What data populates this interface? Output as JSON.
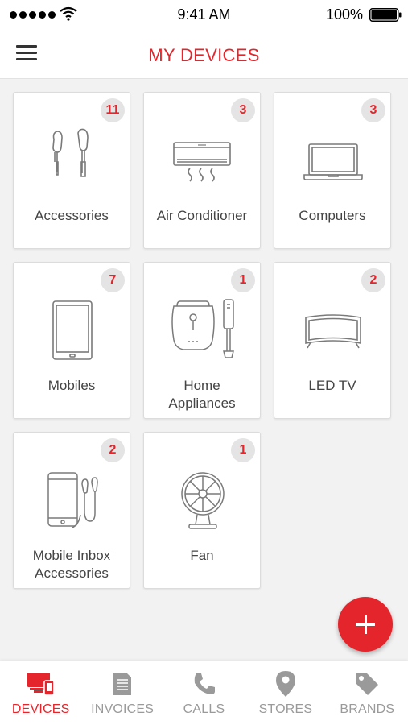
{
  "status_bar": {
    "time": "9:41 AM",
    "battery_pct": "100%"
  },
  "header": {
    "title": "MY DEVICES"
  },
  "devices": [
    {
      "label": "Accessories",
      "count": "11",
      "icon": "earphones-icon"
    },
    {
      "label": "Air Conditioner",
      "count": "3",
      "icon": "air-conditioner-icon"
    },
    {
      "label": "Computers",
      "count": "3",
      "icon": "laptop-icon"
    },
    {
      "label": "Mobiles",
      "count": "7",
      "icon": "tablet-icon"
    },
    {
      "label_line1": "Home",
      "label_line2": "Appliances",
      "count": "1",
      "icon": "home-appliances-icon"
    },
    {
      "label": "LED TV",
      "count": "2",
      "icon": "led-tv-icon"
    },
    {
      "label_line1": "Mobile Inbox",
      "label_line2": "Accessories",
      "count": "2",
      "icon": "phone-earphones-icon"
    },
    {
      "label": "Fan",
      "count": "1",
      "icon": "fan-icon"
    }
  ],
  "fab": {
    "icon": "plus-icon"
  },
  "tabs": [
    {
      "label": "DEVICES",
      "icon": "devices-icon",
      "active": true
    },
    {
      "label": "INVOICES",
      "icon": "document-icon",
      "active": false
    },
    {
      "label": "CALLS",
      "icon": "phone-icon",
      "active": false
    },
    {
      "label": "STORES",
      "icon": "location-pin-icon",
      "active": false
    },
    {
      "label": "BRANDS",
      "icon": "tag-icon",
      "active": false
    }
  ],
  "colors": {
    "accent": "#e4252b",
    "badge_bg": "#e4e4e4",
    "inactive_tab": "#9a9a9a",
    "icon_stroke": "#7a7a7a"
  }
}
